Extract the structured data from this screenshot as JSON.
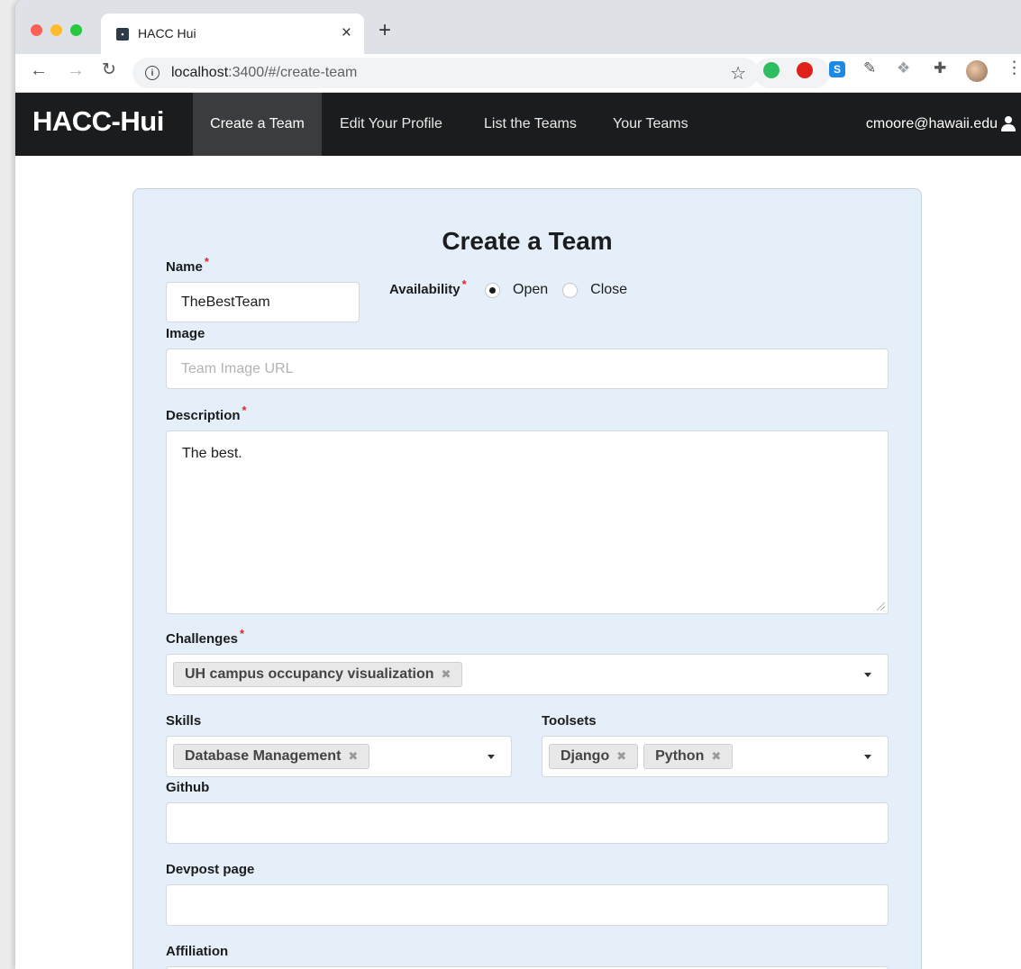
{
  "browser": {
    "tab_title": "HACC Hui",
    "url_host": "localhost",
    "url_rest": ":3400/#/create-team"
  },
  "navbar": {
    "brand": "HACC-Hui",
    "items": [
      {
        "label": "Create a Team",
        "active": true
      },
      {
        "label": "Edit Your Profile",
        "active": false
      },
      {
        "label": "List the Teams",
        "active": false
      },
      {
        "label": "Your Teams",
        "active": false
      }
    ],
    "user_email": "cmoore@hawaii.edu"
  },
  "form": {
    "title": "Create a Team",
    "required_mark": "*",
    "name": {
      "label": "Name",
      "value": "TheBestTeam"
    },
    "availability": {
      "label": "Availability",
      "options": [
        "Open",
        "Close"
      ],
      "selected": "Open"
    },
    "image": {
      "label": "Image",
      "placeholder": "Team Image URL",
      "value": ""
    },
    "description": {
      "label": "Description",
      "value": "The best."
    },
    "challenges": {
      "label": "Challenges",
      "selected": [
        "UH campus occupancy visualization"
      ]
    },
    "skills": {
      "label": "Skills",
      "selected": [
        "Database Management"
      ]
    },
    "toolsets": {
      "label": "Toolsets",
      "selected": [
        "Django",
        "Python"
      ]
    },
    "github": {
      "label": "Github",
      "value": ""
    },
    "devpost": {
      "label": "Devpost page",
      "value": ""
    },
    "affiliation": {
      "label": "Affiliation"
    }
  },
  "colors": {
    "navbar_bg": "#1b1c1d",
    "form_bg": "#e4eff9",
    "required": "#db2828"
  },
  "icons": {
    "chip_remove": "✖"
  }
}
